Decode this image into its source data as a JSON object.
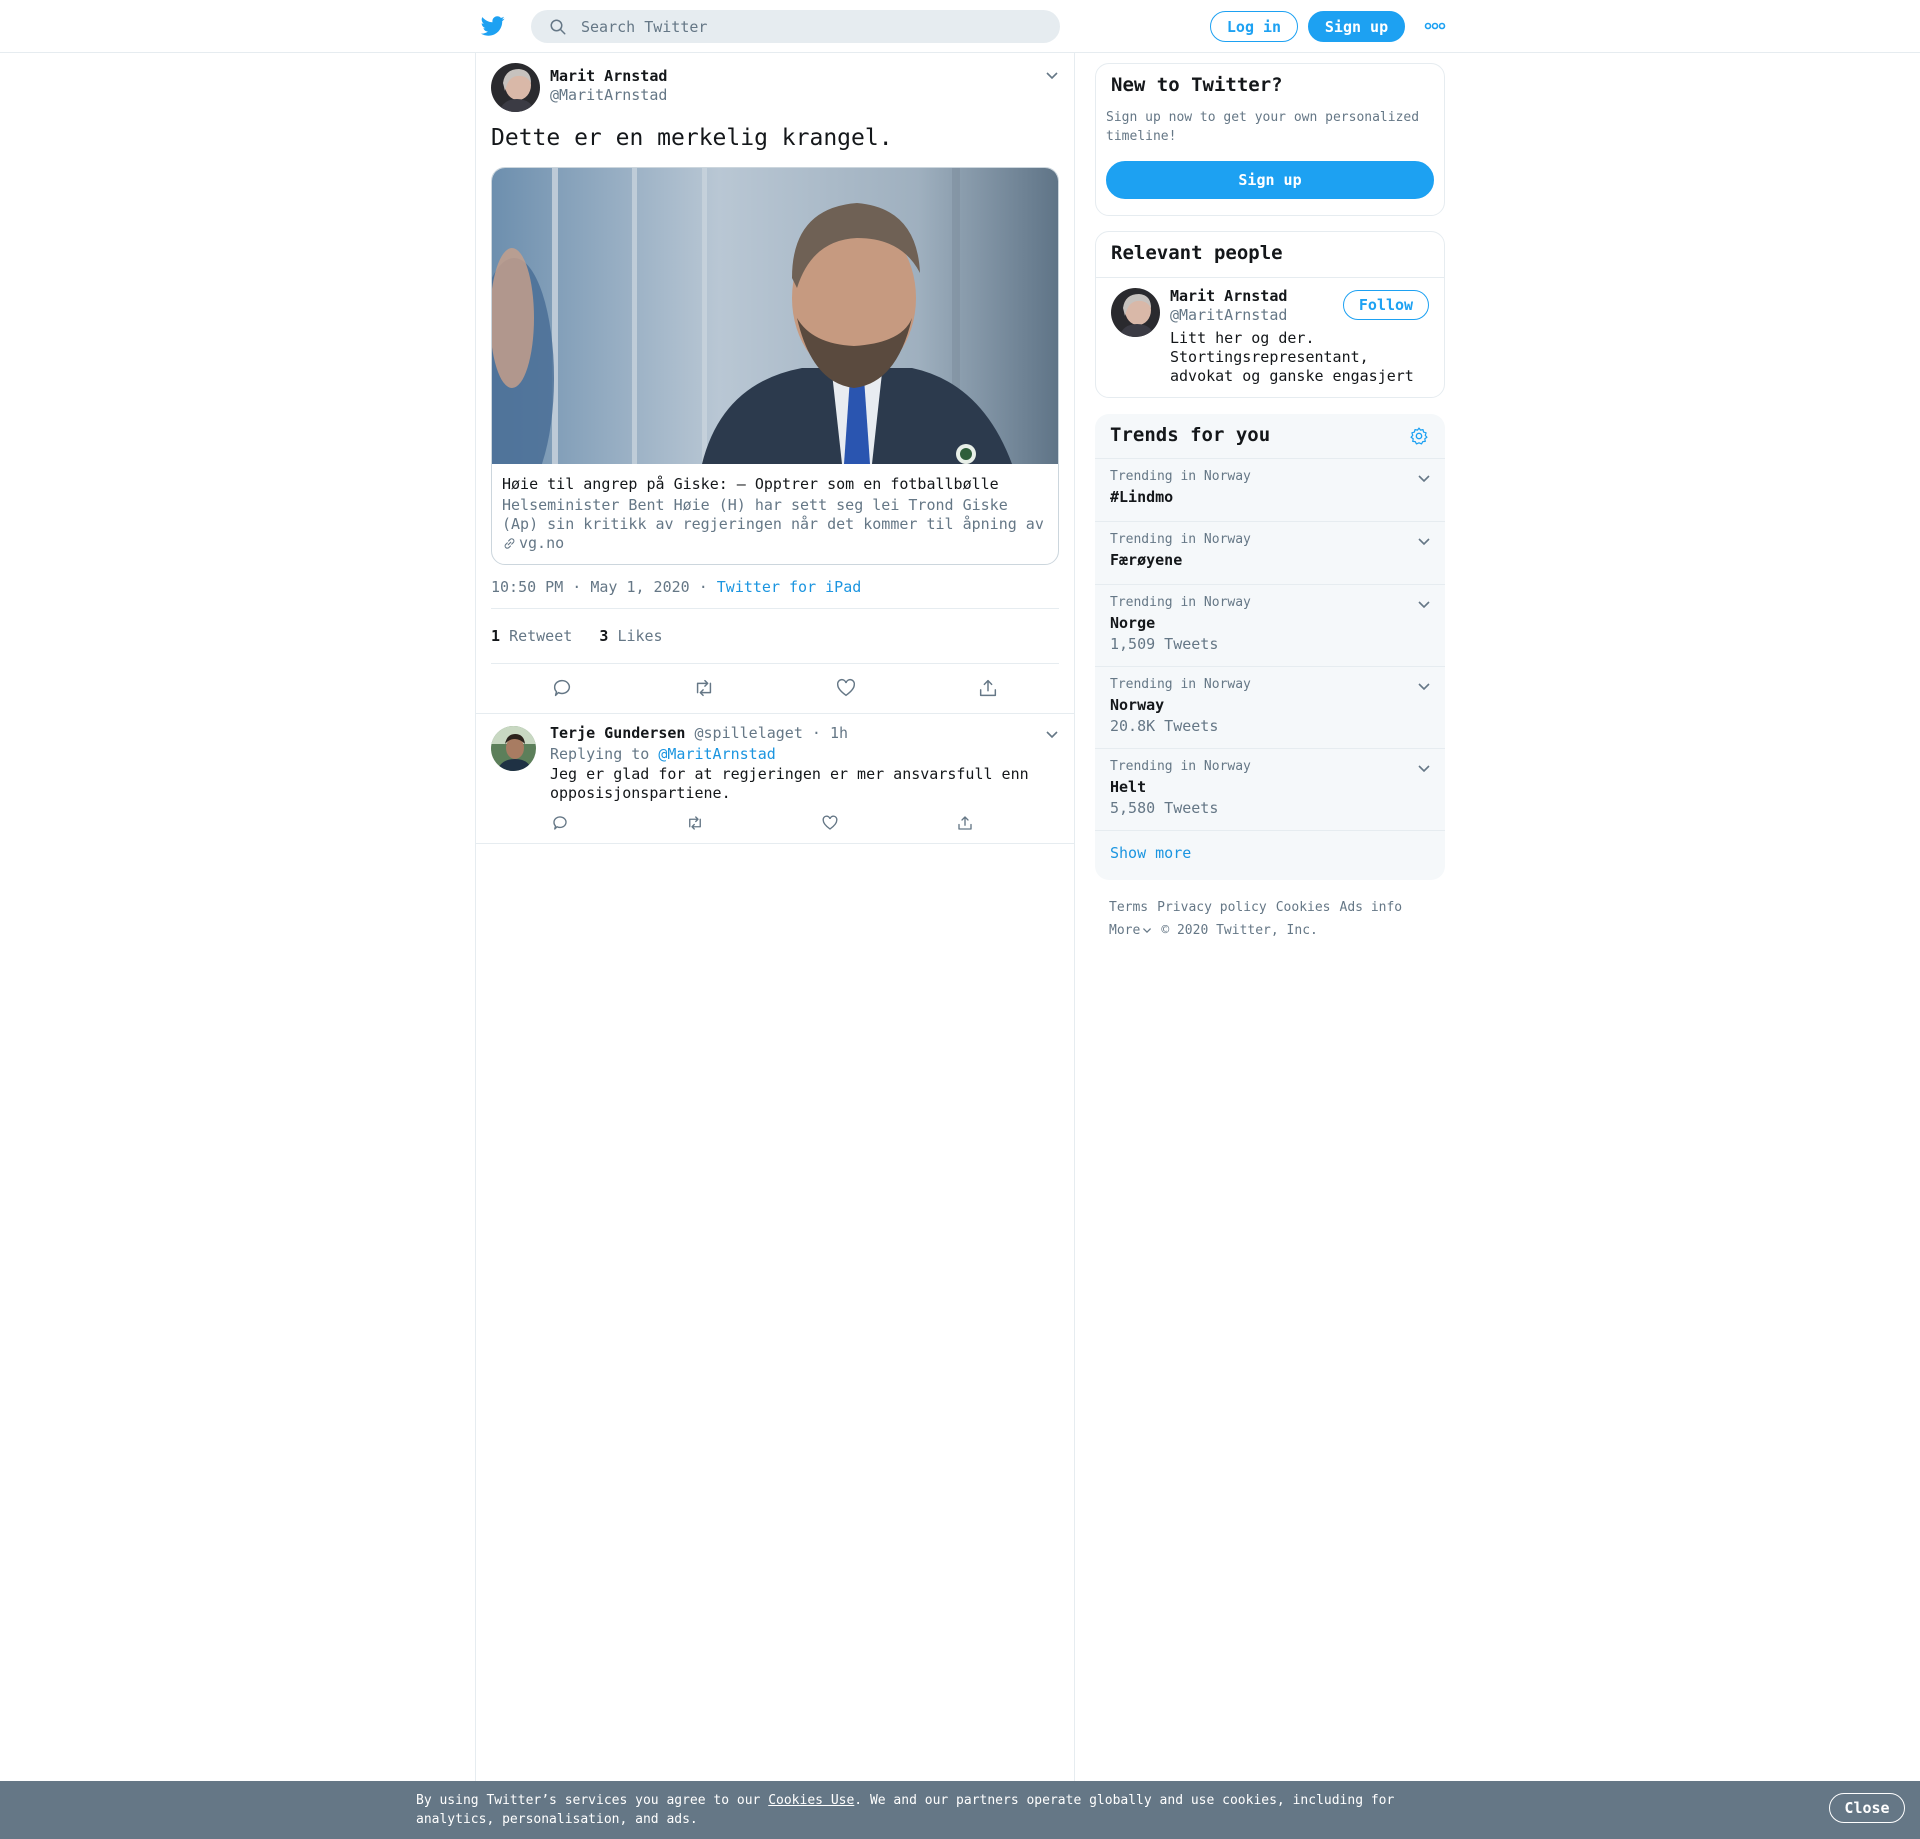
{
  "header": {
    "search_placeholder": "Search Twitter",
    "login_label": "Log in",
    "signup_label": "Sign up"
  },
  "tweet": {
    "author_name": "Marit Arnstad",
    "author_handle": "@MaritArnstad",
    "text": "Dette er en merkelig krangel.",
    "card": {
      "title": "Høie til angrep på Giske: – Opptrer som en fotballbølle",
      "description": "Helseminister Bent Høie (H) har sett seg lei Trond Giske (Ap) sin kritikk av regjeringen når det kommer til åpning av skoler og barnehager.",
      "domain": "vg.no"
    },
    "timestamp": "10:50 PM · May 1, 2020",
    "separator": "·",
    "source": "Twitter for iPad",
    "retweet_count": "1",
    "retweet_label": "Retweet",
    "like_count": "3",
    "like_label": "Likes"
  },
  "reply": {
    "author_name": "Terje Gundersen",
    "author_handle": "@spillelaget",
    "time": "· 1h",
    "replying_to_label": "Replying to",
    "replying_to_handle": "@MaritArnstad",
    "text_line1": "Jeg er glad for at regjeringen er mer ansvarsfull enn",
    "text_line2": "opposisjonspartiene."
  },
  "sidebar": {
    "new_to_twitter": {
      "title": "New to Twitter?",
      "subtitle_line1": "Sign up now to get your own personalized",
      "subtitle_line2": "timeline!",
      "button": "Sign up"
    },
    "relevant_people": {
      "title": "Relevant people",
      "name": "Marit Arnstad",
      "handle": "@MaritArnstad",
      "follow": "Follow",
      "bio_line1": "Litt her og der.",
      "bio_line2": "Stortingsrepresentant,",
      "bio_line3": "advokat og ganske engasjert"
    },
    "trends": {
      "title": "Trends for you",
      "items": [
        {
          "label": "Trending in Norway",
          "name": "#Lindmo",
          "count": ""
        },
        {
          "label": "Trending in Norway",
          "name": "Færøyene",
          "count": ""
        },
        {
          "label": "Trending in Norway",
          "name": "Norge",
          "count": "1,509 Tweets"
        },
        {
          "label": "Trending in Norway",
          "name": "Norway",
          "count": "20.8K Tweets"
        },
        {
          "label": "Trending in Norway",
          "name": "Helt",
          "count": "5,580 Tweets"
        }
      ],
      "show_more": "Show more"
    },
    "footer": {
      "terms": "Terms",
      "privacy": "Privacy policy",
      "cookies": "Cookies",
      "ads": "Ads info",
      "more": "More",
      "copyright": "© 2020 Twitter, Inc."
    }
  },
  "cookie_bar": {
    "text_before": "By using Twitter’s services you agree to our ",
    "link": "Cookies Use",
    "text_after": ". We and our partners operate globally and use cookies, including for analytics, personalisation, and ads.",
    "close": "Close"
  },
  "colors": {
    "brand": "#1da1f2",
    "link": "#1b95e0",
    "muted": "#657786",
    "border": "#e6ecf0",
    "cookie_bg": "#657786"
  }
}
